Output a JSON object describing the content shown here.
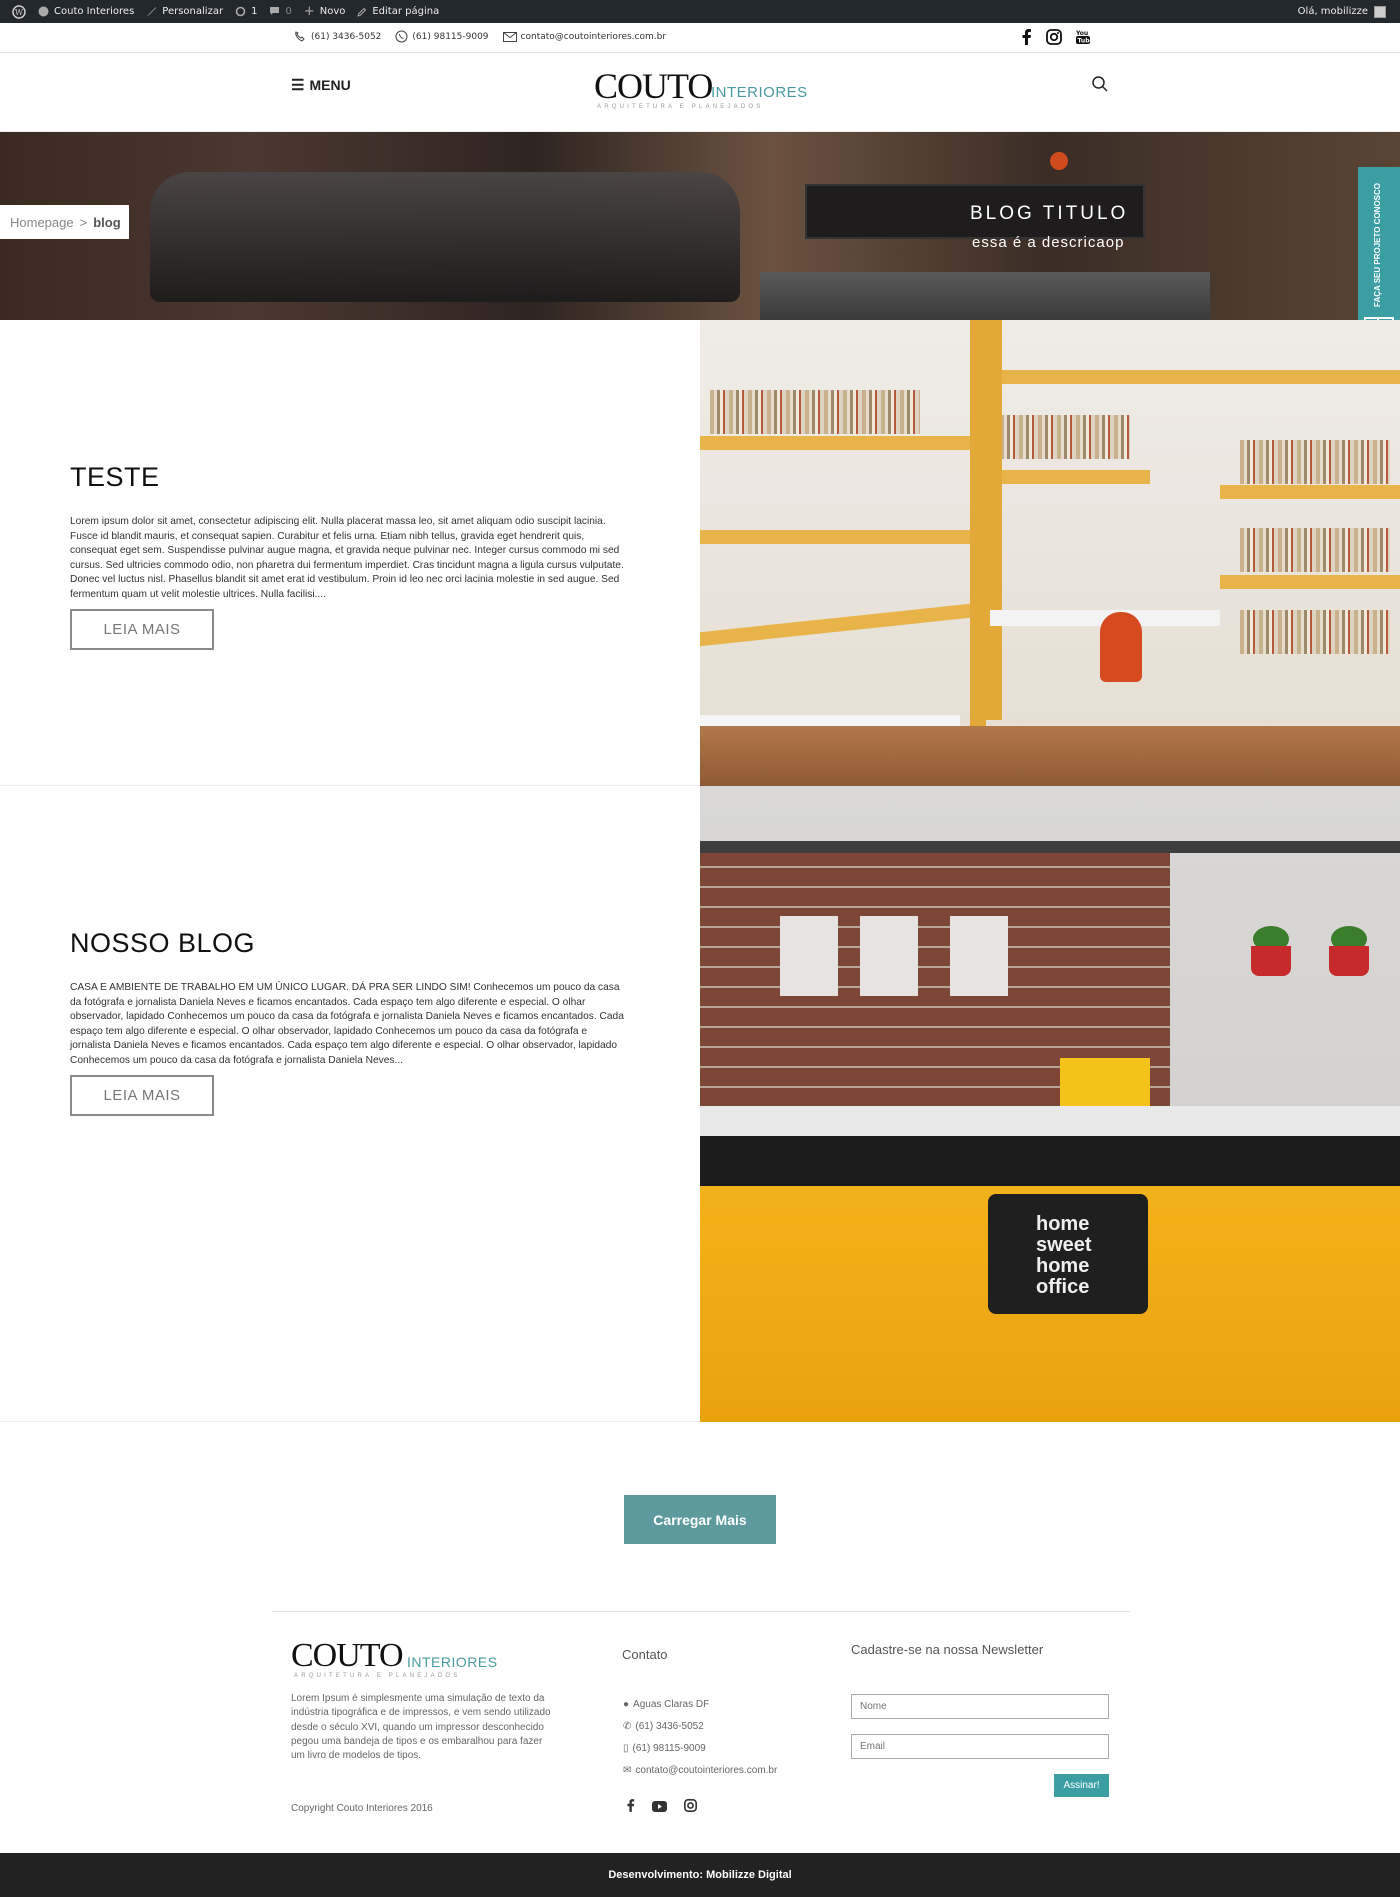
{
  "admin_bar": {
    "site_name": "Couto Interiores",
    "customize": "Personalizar",
    "updates_count": "1",
    "comments_count": "0",
    "new": "Novo",
    "edit_page": "Editar página",
    "greeting": "Olá, mobilizze"
  },
  "topbar": {
    "phone1": "(61) 3436-5052",
    "phone2": "(61) 98115-9009",
    "email": "contato@coutointeriores.com.br",
    "socials": [
      "facebook-icon",
      "instagram-icon",
      "youtube-icon"
    ]
  },
  "header": {
    "menu_label": "MENU",
    "logo_main": "COUTO",
    "logo_sub": "INTERIORES",
    "logo_tag": "ARQUITETURA E PLANEJADOS"
  },
  "hero": {
    "breadcrumb_home": "Homepage",
    "breadcrumb_sep": ">",
    "breadcrumb_current": "blog",
    "title": "BLOG TITULO",
    "description": "essa é a descricaop"
  },
  "side_tab": {
    "label": "FAÇA SEU PROJETO CONOSCO"
  },
  "posts": [
    {
      "title": "TESTE",
      "excerpt": "Lorem ipsum dolor sit amet, consectetur adipiscing elit. Nulla placerat massa leo, sit amet aliquam odio suscipit lacinia. Fusce id blandit mauris, et consequat sapien. Curabitur et felis urna. Etiam nibh tellus, gravida eget hendrerit quis, consequat eget sem. Suspendisse pulvinar augue magna, et gravida neque pulvinar nec. Integer cursus commodo mi sed cursus. Sed ultricies commodo odio, non pharetra dui fermentum imperdiet. Cras tincidunt magna a ligula cursus vulputate. Donec vel luctus nisl. Phasellus blandit sit amet erat id vestibulum. Proin id leo nec orci lacinia molestie in sed augue. Sed fermentum quam ut velit molestie ultrices. Nulla facilisi....",
      "button": "LEIA MAIS"
    },
    {
      "title": "NOSSO BLOG",
      "excerpt": "CASA E AMBIENTE DE TRABALHO EM UM ÚNICO LUGAR. DÁ PRA SER LINDO SIM! Conhecemos um pouco da casa da fotógrafa e jornalista Daniela Neves e ficamos encantados. Cada espaço tem algo diferente e especial. O olhar observador, lapidado Conhecemos um pouco da casa da fotógrafa e jornalista Daniela Neves e ficamos encantados. Cada espaço tem algo diferente e especial. O olhar observador, lapidado Conhecemos um pouco da casa da fotógrafa e jornalista Daniela Neves e ficamos encantados. Cada espaço tem algo diferente e especial. O olhar observador, lapidado Conhecemos um pouco da casa da fotógrafa e jornalista Daniela Neves...",
      "button": "LEIA MAIS",
      "image_text": "home sweet home office"
    }
  ],
  "load_more": "Carregar Mais",
  "footer": {
    "about": "Lorem Ipsum é simplesmente uma simulação de texto da indústria tipográfica e de impressos, e vem sendo utilizado desde o século XVI, quando um impressor desconhecido pegou uma bandeja de tipos e os embaralhou para fazer um livro de modelos de tipos.",
    "copyright": "Copyright Couto Interiores 2016",
    "contact_title": "Contato",
    "address": "Aguas Claras DF",
    "phone1": "(61) 3436-5052",
    "phone2": "(61) 98115-9009",
    "email": "contato@coutointeriores.com.br",
    "newsletter_title": "Cadastre-se na nossa Newsletter",
    "name_placeholder": "Nome",
    "email_placeholder": "Email",
    "submit": "Assinar!",
    "credits": "Desenvolvimento: Mobilizze Digital"
  },
  "colors": {
    "accent": "#3a9ea3",
    "button": "#5d9a9e",
    "admin_bar": "#23282d",
    "bottom_bar": "#222222"
  }
}
